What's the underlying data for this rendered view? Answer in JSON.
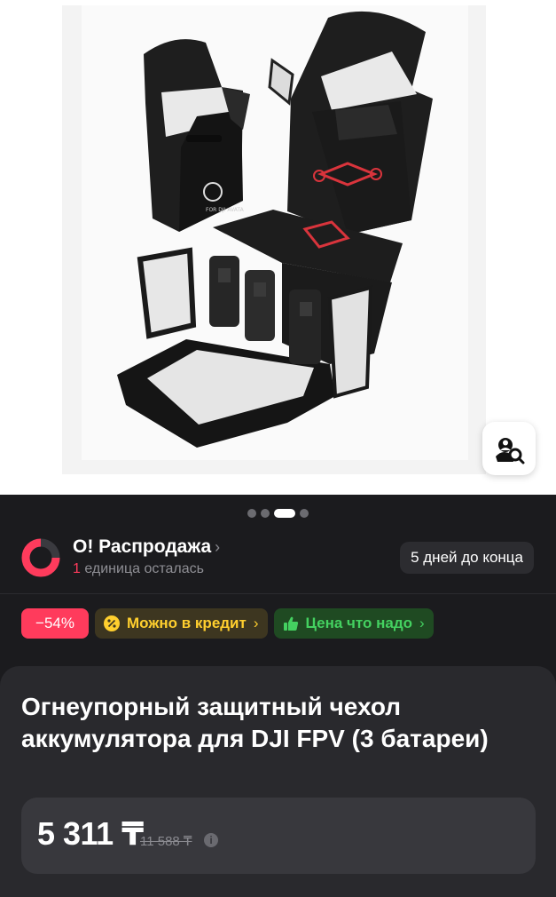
{
  "gallery": {
    "dots_count": 4,
    "active_dot": 2,
    "image_alt": "product-photo-battery-bags"
  },
  "sale": {
    "title": "О! Распродажа",
    "remaining_count": "1",
    "remaining_text": " единица осталась",
    "timer": "5 дней до конца"
  },
  "badges": {
    "discount": "−54%",
    "credit": "Можно в кредит",
    "price": "Цена что надо"
  },
  "product": {
    "title": "Огнеупорный защитный чехол аккумулятора для DJI FPV (3 батареи)",
    "price_current": "5 311 ₸",
    "price_old": "11 588 ₸"
  },
  "colors": {
    "accent_red": "#ff3b5c",
    "credit_yellow": "#ffcf2e",
    "price_green": "#44d160"
  }
}
